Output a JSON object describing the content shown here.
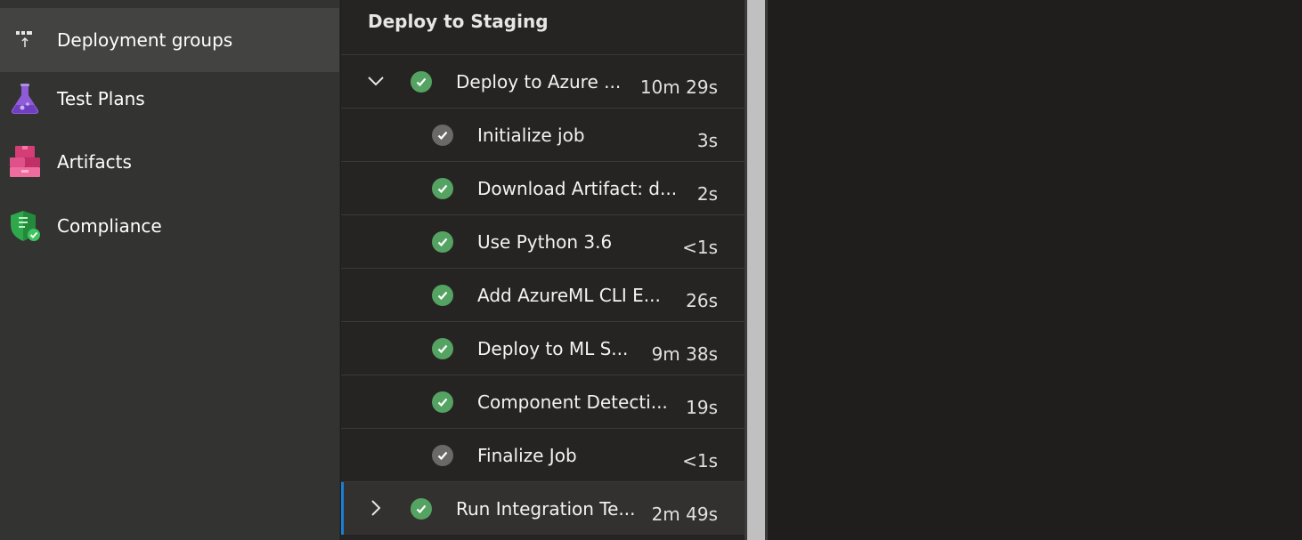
{
  "sidebar": {
    "items": [
      {
        "label": "Deployment groups",
        "icon": "deployment-groups-icon",
        "selected": true
      },
      {
        "label": "Test Plans",
        "icon": "test-plans-flask-icon",
        "selected": false
      },
      {
        "label": "Artifacts",
        "icon": "artifacts-boxes-icon",
        "selected": false
      },
      {
        "label": "Compliance",
        "icon": "compliance-shield-icon",
        "selected": false
      }
    ]
  },
  "stage": {
    "title": "Deploy to Staging",
    "jobs": [
      {
        "name": "Deploy to Azure ...",
        "duration": "10m 29s",
        "status": "succeeded",
        "expanded": true,
        "steps": [
          {
            "name": "Initialize job",
            "duration": "3s",
            "status": "completed"
          },
          {
            "name": "Download Artifact: d...",
            "duration": "2s",
            "status": "succeeded"
          },
          {
            "name": "Use Python 3.6",
            "duration": "<1s",
            "status": "succeeded"
          },
          {
            "name": "Add AzureML CLI E...",
            "duration": "26s",
            "status": "succeeded"
          },
          {
            "name": "Deploy to ML S...",
            "duration": "9m 38s",
            "status": "succeeded"
          },
          {
            "name": "Component Detecti...",
            "duration": "19s",
            "status": "succeeded"
          },
          {
            "name": "Finalize Job",
            "duration": "<1s",
            "status": "completed"
          }
        ]
      },
      {
        "name": "Run Integration Te...",
        "duration": "2m 49s",
        "status": "succeeded",
        "expanded": false
      }
    ]
  },
  "colors": {
    "success": "#55a362",
    "completed": "#6a6968",
    "accent": "#1a7ed6"
  }
}
